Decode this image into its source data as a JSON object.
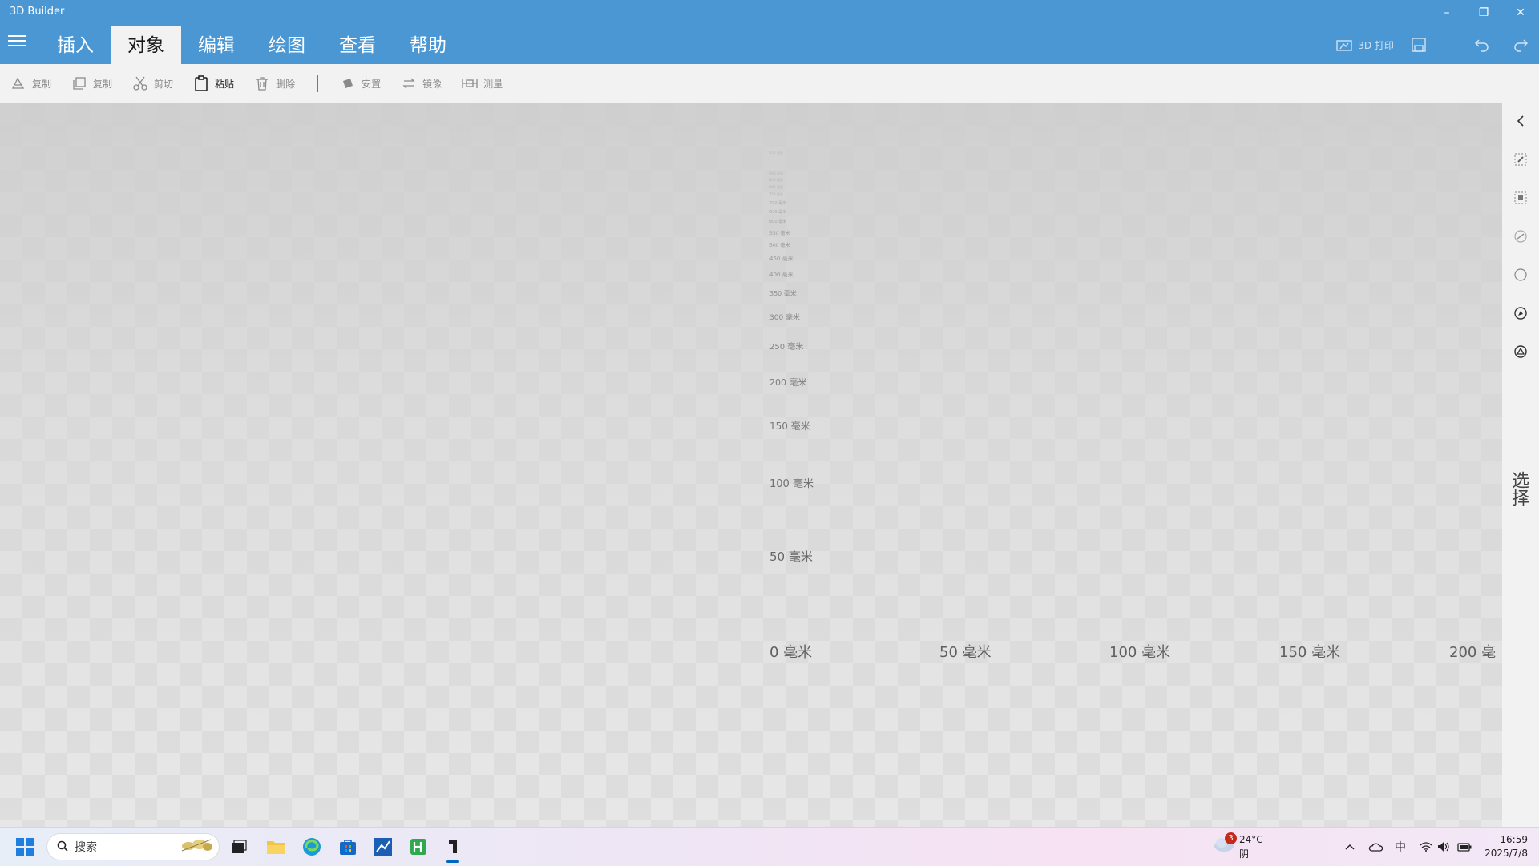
{
  "window": {
    "title": "3D Builder",
    "controls": {
      "minimize": "–",
      "restore": "❐",
      "close": "✕"
    }
  },
  "menu": {
    "tabs": [
      "插入",
      "对象",
      "编辑",
      "绘图",
      "查看",
      "帮助"
    ],
    "active_tab": "对象",
    "print_label": "3D 打印"
  },
  "ribbon": {
    "items": [
      {
        "icon": "duplicate-shape-icon",
        "label": "复制",
        "enabled": false
      },
      {
        "icon": "copy-icon",
        "label": "复制",
        "enabled": false
      },
      {
        "icon": "scissors-icon",
        "label": "剪切",
        "enabled": false
      },
      {
        "icon": "clipboard-icon",
        "label": "粘贴",
        "enabled": true
      },
      {
        "icon": "trash-icon",
        "label": "删除",
        "enabled": false
      },
      {
        "icon": "settle-icon",
        "label": "安置",
        "enabled": false
      },
      {
        "icon": "mirror-icon",
        "label": "镜像",
        "enabled": false
      },
      {
        "icon": "measure-icon",
        "label": "测量",
        "enabled": false
      }
    ]
  },
  "viewport": {
    "z_scale": [
      "50 毫米",
      "100 毫米",
      "150 毫米",
      "200 毫米",
      "250 毫米",
      "300 毫米",
      "350 毫米",
      "400 毫米",
      "450 毫米",
      "500 毫米",
      "550 毫米",
      "600 毫米",
      "650 毫米",
      "700 毫米",
      "750 毫米",
      "800 毫米",
      "850 毫米",
      "900 毫米",
      "950 毫米"
    ],
    "x_scale": [
      "0 毫米",
      "50 毫米",
      "100 毫米",
      "150 毫米",
      "200 毫"
    ]
  },
  "sidepanel": {
    "label": "选择",
    "icons": [
      "collapse-chevron-icon",
      "select-object-icon",
      "select-face-icon",
      "select-edge-icon",
      "select-vertex-icon",
      "select-body-icon",
      "select-triangle-icon"
    ]
  },
  "taskbar": {
    "search_placeholder": "搜索",
    "weather": {
      "temp": "24°C",
      "condition": "阴",
      "badge": "3"
    },
    "ime": "中",
    "time": "16:59",
    "date": "2025/7/8"
  },
  "colors": {
    "accent": "#4a97d3",
    "ribbon_bg": "#f2f2f2",
    "viewport_bg": "#d9d9d9"
  }
}
